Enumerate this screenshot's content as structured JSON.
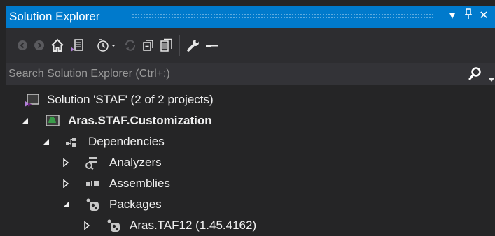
{
  "window": {
    "title": "Solution Explorer",
    "pin_glyph": "Ŵ",
    "close_glyph": "✕",
    "dropdown_glyph": "▾"
  },
  "toolbar": {
    "buttons": [
      "back-icon",
      "forward-icon",
      "home-icon",
      "switch-views-icon",
      "pending-changes-filter-icon",
      "sync-icon",
      "collapse-all-icon",
      "show-all-files-icon",
      "properties-icon",
      "preview-icon"
    ]
  },
  "search": {
    "placeholder": "Search Solution Explorer (Ctrl+;)"
  },
  "tree": {
    "solution": "Solution 'STAF' (2 of 2 projects)",
    "project": "Aras.STAF.Customization",
    "dependencies": "Dependencies",
    "analyzers": "Analyzers",
    "assemblies": "Assemblies",
    "packages": "Packages",
    "package_item": "Aras.TAF12 (1.45.4162)"
  },
  "colors": {
    "accent": "#007acc",
    "background": "#252526",
    "toolbar": "#2d2d30",
    "search": "#333337",
    "text": "#f1f1f1"
  }
}
